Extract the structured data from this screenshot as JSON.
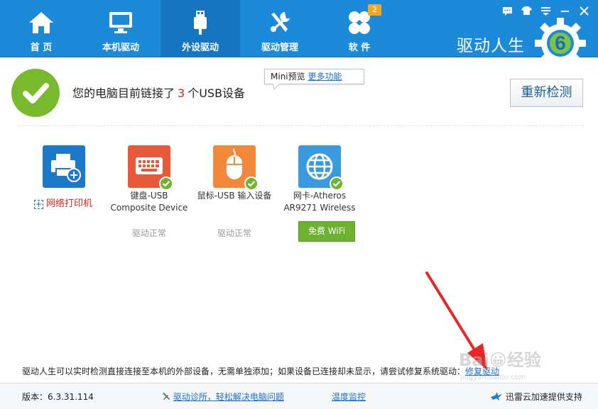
{
  "nav": {
    "items": [
      {
        "label": "首 页",
        "icon": "home-icon"
      },
      {
        "label": "本机驱动",
        "icon": "monitor-icon"
      },
      {
        "label": "外设驱动",
        "icon": "usb-icon",
        "active": true
      },
      {
        "label": "驱动管理",
        "icon": "tools-icon"
      },
      {
        "label": "软 件",
        "icon": "apps-icon",
        "badge": "2"
      }
    ]
  },
  "brand": {
    "name": "驱动人生",
    "logo_digit": "6"
  },
  "status": {
    "prefix": "您的电脑目前链接了",
    "count": "3",
    "suffix": "个USB设备",
    "recheck_label": "重新检测"
  },
  "tooltip": {
    "label": "Mini预览",
    "link": "更多功能"
  },
  "devices": {
    "printer": {
      "label": "网络打印机",
      "plus": "+"
    },
    "keyboard": {
      "name": "键盘-USB\nComposite Device",
      "status": "驱动正常"
    },
    "mouse": {
      "name": "鼠标-USB 输入设备",
      "status": "驱动正常"
    },
    "network": {
      "name": "网卡-Atheros\nAR9271 Wireless",
      "button": "免费 WiFi"
    }
  },
  "notice": {
    "text": "驱动人生可以实时检测直接连接至本机的外部设备，无需单独添加；如果设备已连接却未显示，请尝试修复系统驱动：",
    "link": "修复驱动"
  },
  "footer": {
    "version": "版本：6.3.31.114",
    "diagnose": "驱动诊所，轻松解决电脑问题",
    "temperature": "温度监控",
    "cloud": "迅雷云加速提供支持"
  },
  "colors": {
    "header": "#1b8ad9",
    "active_tab": "#1675c0",
    "accent_green": "#79b92e",
    "count_red": "#d9261c",
    "link_blue": "#1a6fd0"
  }
}
